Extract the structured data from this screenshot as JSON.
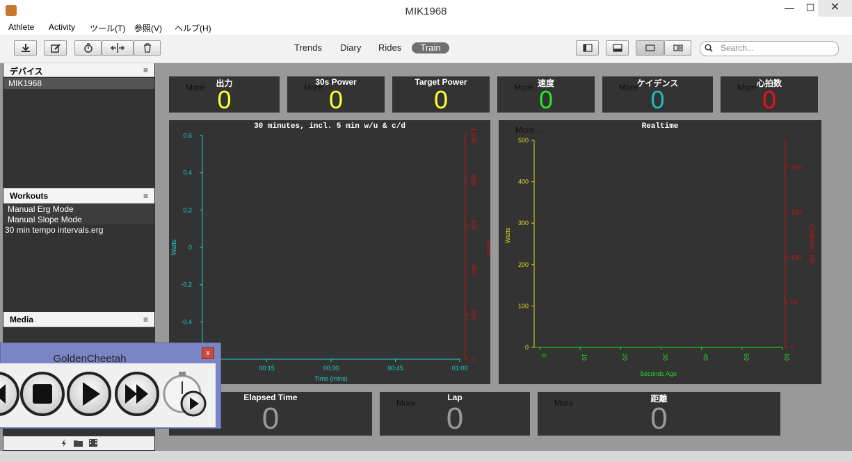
{
  "window": {
    "title": "MIK1968",
    "minimize": "—",
    "maximize": "☐",
    "close": "✕"
  },
  "menu": [
    "Athlete",
    "Activity",
    "ツール(T)",
    "参照(V)",
    "ヘルプ(H)"
  ],
  "views": {
    "trends": "Trends",
    "diary": "Diary",
    "rides": "Rides",
    "train": "Train"
  },
  "search": {
    "placeholder": "Search..."
  },
  "sidebar": {
    "devices_title": "デバイス",
    "devices": [
      "MIK1968"
    ],
    "workouts_title": "Workouts",
    "workouts": [
      "Manual Erg Mode",
      "Manual Slope Mode",
      "30 min tempo intervals.erg"
    ],
    "media_title": "Media",
    "menu_glyph": "≡"
  },
  "metrics": [
    {
      "title": "出力",
      "more": "More",
      "value": "0",
      "color": "#ffff33"
    },
    {
      "title": "30s Power",
      "more": "More",
      "value": "0",
      "color": "#ffff33"
    },
    {
      "title": "Target Power",
      "more": "",
      "value": "0",
      "color": "#ffff33"
    },
    {
      "title": "速度",
      "more": "More",
      "value": "0",
      "color": "#22ee22"
    },
    {
      "title": "ケイデンス",
      "more": "More",
      "value": "0",
      "color": "#22bbbb"
    },
    {
      "title": "心拍数",
      "more": "More",
      "value": "0",
      "color": "#ee1111"
    }
  ],
  "bottom_metrics": [
    {
      "title": "Elapsed Time",
      "more": "",
      "value": "0",
      "color": "#9a9a9a"
    },
    {
      "title": "Lap",
      "more": "More",
      "value": "0",
      "color": "#9a9a9a"
    },
    {
      "title": "距離",
      "more": "More",
      "value": "0",
      "color": "#9a9a9a"
    }
  ],
  "chart_data": [
    {
      "type": "line",
      "title": "30 minutes, incl. 5 min w/u & c/d",
      "xlabel": "Time (mins)",
      "ylabel": "Watts",
      "y2label": "Watts",
      "x_ticks": [
        "00:15",
        "00:30",
        "00:45",
        "01:00"
      ],
      "y_ticks": [
        "0.6",
        "0.4",
        "0.2",
        "0",
        "-0.2",
        "-0.4"
      ],
      "y2_ticks": [
        "1,000",
        "800",
        "600",
        "400",
        "200",
        "0"
      ],
      "ylim": [
        -0.6,
        0.6
      ],
      "y2lim": [
        0,
        1000
      ],
      "series": []
    },
    {
      "type": "line",
      "title": "Realtime",
      "more": "More...",
      "xlabel": "Seconds Ago",
      "ylabel": "Watts",
      "y2label": "Cadence / HR",
      "x_ticks": [
        "0",
        "10",
        "20",
        "30",
        "40",
        "50",
        "60"
      ],
      "y_ticks": [
        "500",
        "400",
        "300",
        "200",
        "100",
        "0"
      ],
      "y2_ticks": [
        "200",
        "150",
        "100",
        "50",
        "0"
      ],
      "ylim": [
        0,
        500
      ],
      "y2lim": [
        0,
        230
      ],
      "series": [
        {
          "values": [
            0,
            0
          ]
        }
      ]
    }
  ],
  "dialog": {
    "title": "GoldenCheetah",
    "close": "x"
  },
  "colors": {
    "panel": "#333333",
    "background": "#999999",
    "power": "#ffff33",
    "speed": "#22ee22",
    "cadence": "#22bbbb",
    "hr": "#ee1111"
  }
}
